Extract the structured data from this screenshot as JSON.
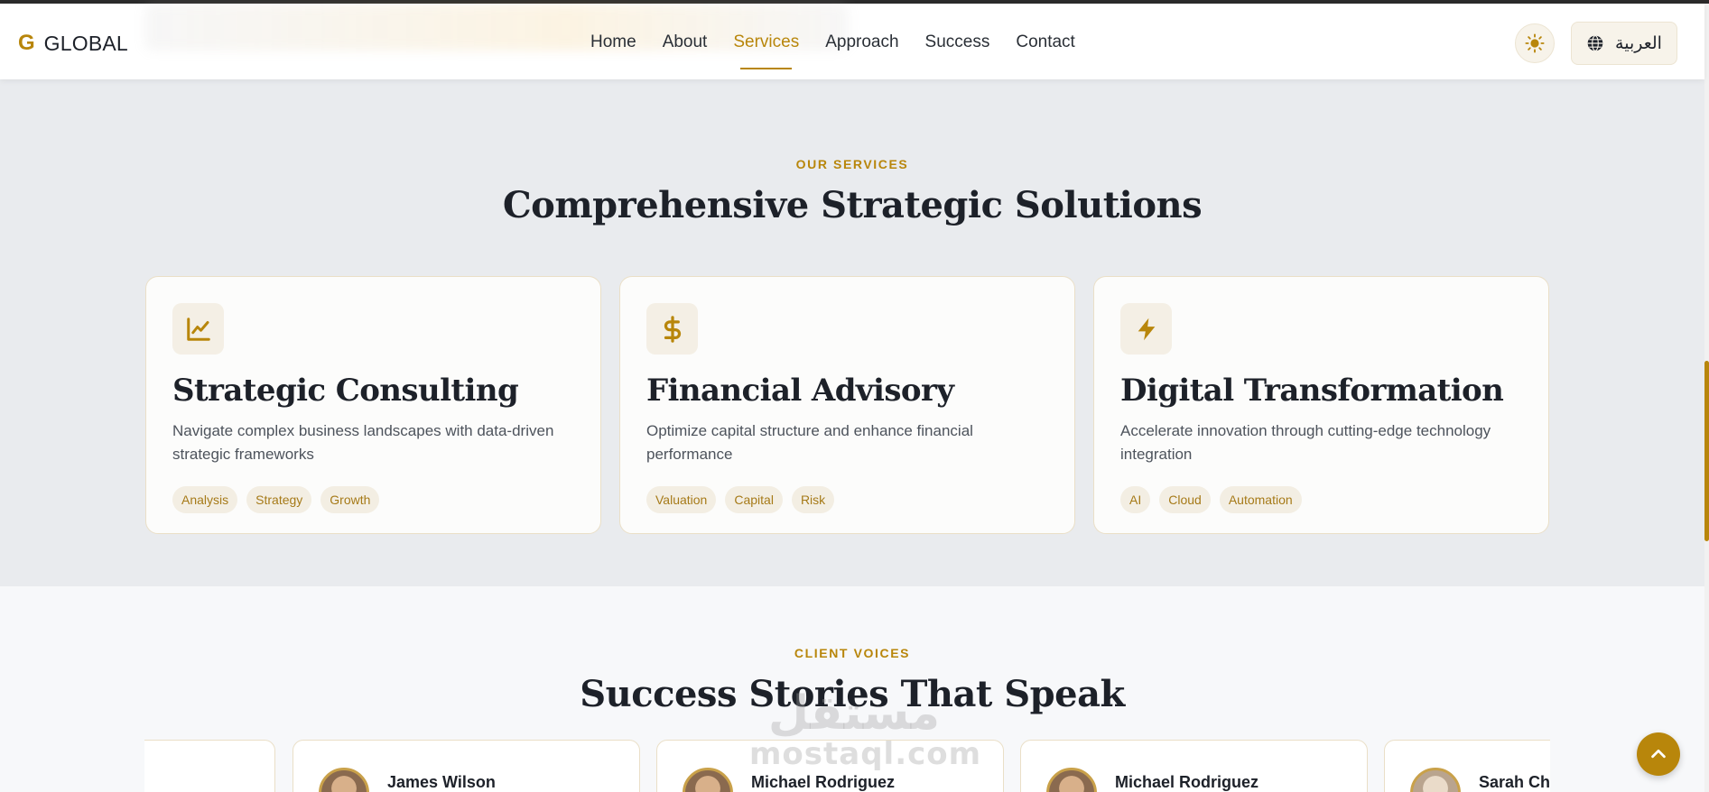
{
  "brand": {
    "mark": "G",
    "name": "GLOBAL"
  },
  "nav": [
    {
      "label": "Home",
      "active": false
    },
    {
      "label": "About",
      "active": false
    },
    {
      "label": "Services",
      "active": true
    },
    {
      "label": "Approach",
      "active": false
    },
    {
      "label": "Success",
      "active": false
    },
    {
      "label": "Contact",
      "active": false
    }
  ],
  "header": {
    "theme_icon": "sun-icon",
    "language_label": "العربية",
    "language_icon": "globe-icon"
  },
  "services": {
    "eyebrow": "OUR SERVICES",
    "title": "Comprehensive Strategic Solutions",
    "cards": [
      {
        "icon": "chart-line-icon",
        "title": "Strategic Consulting",
        "description": "Navigate complex business landscapes with data-driven strategic frameworks",
        "tags": [
          "Analysis",
          "Strategy",
          "Growth"
        ]
      },
      {
        "icon": "dollar-icon",
        "title": "Financial Advisory",
        "description": "Optimize capital structure and enhance financial performance",
        "tags": [
          "Valuation",
          "Capital",
          "Risk"
        ]
      },
      {
        "icon": "bolt-icon",
        "title": "Digital Transformation",
        "description": "Accelerate innovation through cutting-edge technology integration",
        "tags": [
          "AI",
          "Cloud",
          "Automation"
        ]
      }
    ]
  },
  "testimonials": {
    "eyebrow": "CLIENT VOICES",
    "title": "Success Stories That Speak",
    "people": [
      "James Wilson",
      "Michael Rodriguez",
      "Michael Rodriguez",
      "Sarah Ch"
    ]
  },
  "watermark": {
    "arabic": "مستقل",
    "latin": "mostaql.com"
  },
  "colors": {
    "accent": "#b8860b",
    "section_bg": "#e9ebee",
    "card_border": "#eadfc7"
  }
}
